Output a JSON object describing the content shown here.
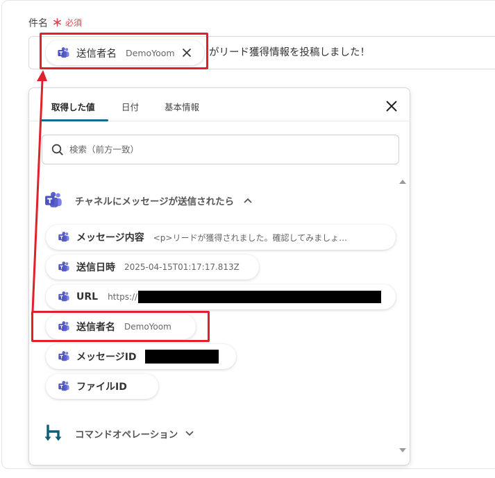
{
  "field": {
    "label": "件名",
    "required_mark": "＊",
    "required_text": "必須"
  },
  "subject": {
    "chip": {
      "name": "送信者名",
      "value": "DemoYoom"
    },
    "suffix_text": "がリード獲得情報を投稿しました！"
  },
  "panel": {
    "tabs": [
      {
        "label": "取得した値",
        "active": true
      },
      {
        "label": "日付",
        "active": false
      },
      {
        "label": "基本情報",
        "active": false
      }
    ],
    "search_placeholder": "検索（前方一致）",
    "sections": [
      {
        "title": "チャネルにメッセージが送信されたら",
        "expanded": true,
        "icon": "teams-icon"
      },
      {
        "title": "コマンドオペレーション",
        "expanded": false,
        "icon": "yoom-command-icon"
      }
    ],
    "items": [
      {
        "name": "メッセージ内容",
        "value": "<p>リードが獲得されました。確認してみましょ…"
      },
      {
        "name": "送信日時",
        "value": "2025-04-15T01:17:17.813Z"
      },
      {
        "name": "URL",
        "value": "https://"
      },
      {
        "name": "送信者名",
        "value": "DemoYoom"
      },
      {
        "name": "メッセージID",
        "value": ""
      },
      {
        "name": "ファイルID",
        "value": ""
      }
    ]
  },
  "colors": {
    "accent": "#116a91",
    "required": "#e3414b",
    "annotation": "#e0202b",
    "teams": "#5b5fc7"
  }
}
